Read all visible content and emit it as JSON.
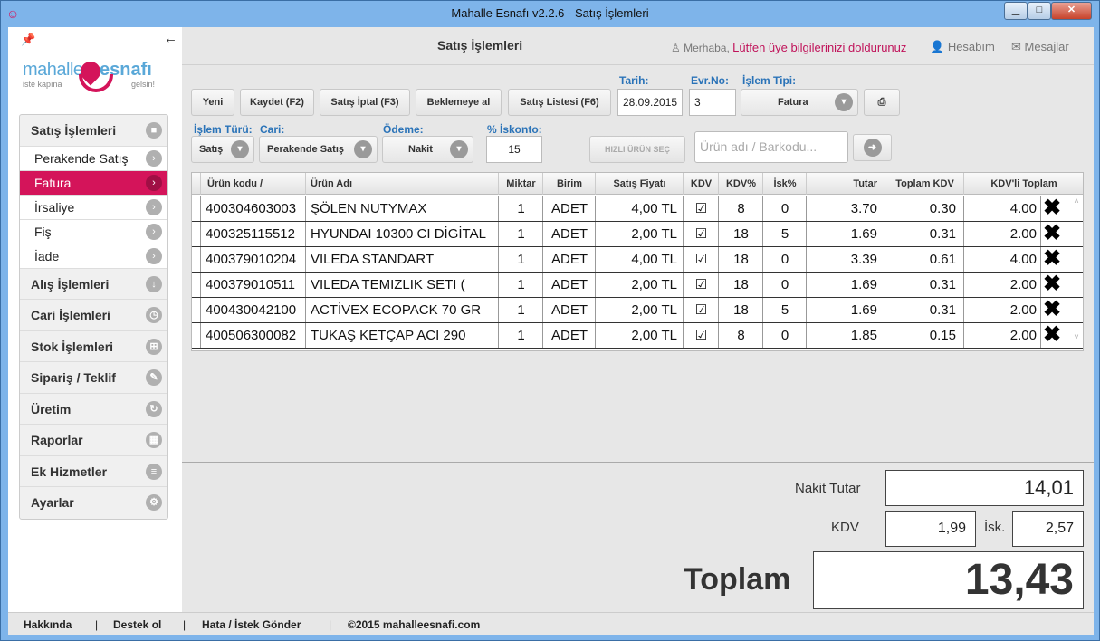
{
  "window": {
    "title": "Mahalle Esnafı v2.2.6 - Satış İşlemleri"
  },
  "logo": {
    "brand_left": "mahalle",
    "brand_right": "esnafı",
    "slogan_left": "iste kapına",
    "slogan_right": "gelsin!"
  },
  "sidebar": {
    "sales_header": "Satış İşlemleri",
    "sales_items": [
      {
        "label": "Perakende Satış"
      },
      {
        "label": "Fatura"
      },
      {
        "label": "İrsaliye"
      },
      {
        "label": "Fiş"
      },
      {
        "label": "İade"
      }
    ],
    "sections": [
      {
        "label": "Alış İşlemleri"
      },
      {
        "label": "Cari İşlemleri"
      },
      {
        "label": "Stok İşlemleri"
      },
      {
        "label": "Sipariş / Teklif"
      },
      {
        "label": "Üretim"
      },
      {
        "label": "Raporlar"
      },
      {
        "label": "Ek Hizmetler"
      },
      {
        "label": "Ayarlar"
      }
    ]
  },
  "header": {
    "title": "Satış İşlemleri",
    "greeting": "Merhaba,",
    "profile_link": "Lütfen üye bilgilerinizi doldurunuz",
    "account": "Hesabım",
    "messages": "Mesajlar"
  },
  "toolbar": {
    "new": "Yeni",
    "save": "Kaydet (F2)",
    "cancel": "Satış İptal (F3)",
    "hold": "Beklemeye al",
    "list": "Satış Listesi (F6)",
    "date_label": "Tarih:",
    "date_value": "28.09.2015",
    "docno_label": "Evr.No:",
    "docno_value": "3",
    "optype_label": "İşlem Tipi:",
    "optype_value": "Fatura"
  },
  "filters": {
    "optrans_label": "İşlem Türü:",
    "optrans_value": "Satış",
    "account_label": "Cari:",
    "account_value": "Perakende Satış",
    "payment_label": "Ödeme:",
    "payment_value": "Nakit",
    "discount_label": "% İskonto:",
    "discount_value": "15",
    "quick_product": "HIZLI ÜRÜN SEÇ",
    "product_search_placeholder": "Ürün adı / Barkodu..."
  },
  "grid": {
    "headers": [
      "Ürün kodu /",
      "Ürün Adı",
      "Miktar",
      "Birim",
      "Satış Fiyatı",
      "KDV",
      "KDV%",
      "İsk%",
      "Tutar",
      "Toplam KDV",
      "KDV'li Toplam"
    ],
    "rows": [
      [
        "400304603003",
        "ŞÖLEN NUTYMAX",
        "1",
        "ADET",
        "4,00 TL",
        "☑",
        "8",
        "0",
        "3.70",
        "0.30",
        "4.00"
      ],
      [
        "400325115512",
        "HYUNDAI 10300 CI DİGİTAL",
        "1",
        "ADET",
        "2,00 TL",
        "☑",
        "18",
        "5",
        "1.69",
        "0.31",
        "2.00"
      ],
      [
        "400379010204",
        "VILEDA STANDART",
        "1",
        "ADET",
        "4,00 TL",
        "☑",
        "18",
        "0",
        "3.39",
        "0.61",
        "4.00"
      ],
      [
        "400379010511",
        "VILEDA TEMIZLIK SETI (",
        "1",
        "ADET",
        "2,00 TL",
        "☑",
        "18",
        "0",
        "1.69",
        "0.31",
        "2.00"
      ],
      [
        "400430042100",
        "ACTİVEX ECOPACK 70 GR",
        "1",
        "ADET",
        "2,00 TL",
        "☑",
        "18",
        "5",
        "1.69",
        "0.31",
        "2.00"
      ],
      [
        "400506300082",
        "TUKAŞ KETÇAP ACI 290",
        "1",
        "ADET",
        "2,00 TL",
        "☑",
        "8",
        "0",
        "1.85",
        "0.15",
        "2.00"
      ]
    ]
  },
  "totals": {
    "cash_label": "Nakit Tutar",
    "cash_value": "14,01",
    "vat_label": "KDV",
    "vat_value": "1,99",
    "disc_label": "İsk.",
    "disc_value": "2,57",
    "total_label": "Toplam",
    "total_value": "13,43"
  },
  "footer": {
    "about": "Hakkında",
    "support": "Destek ol",
    "report": "Hata / İstek Gönder",
    "copyright": "©2015 mahalleesnafi.com"
  }
}
